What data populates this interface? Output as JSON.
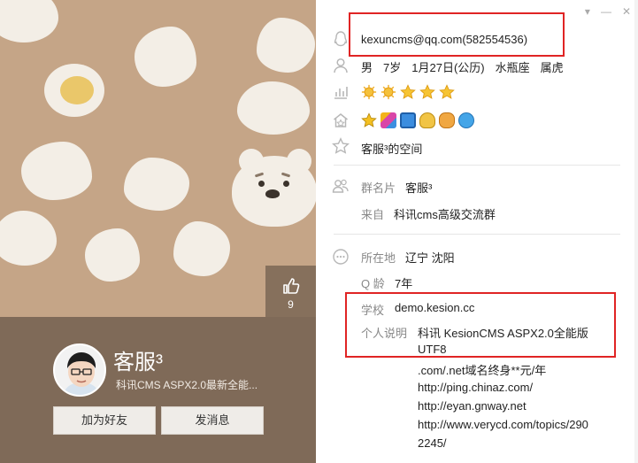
{
  "window": {
    "min_glyph": "▾",
    "min2_glyph": "—",
    "close_glyph": "✕"
  },
  "left": {
    "like_count": "9",
    "nickname": "客服³",
    "signature": "科讯CMS ASPX2.0最新全能...",
    "add_friend_label": "加为好友",
    "send_message_label": "发消息"
  },
  "profile": {
    "account": "kexuncms@qq.com(582554536)",
    "gender": "男",
    "age": "7岁",
    "birthday": "1月27日(公历)",
    "zodiac": "水瓶座",
    "chinese_zodiac": "属虎",
    "space_link": "客服³的空间",
    "group_card_label": "群名片",
    "group_card_value": "客服³",
    "from_label": "来自",
    "from_value": "科讯cms高级交流群",
    "location_label": "所在地",
    "location_value": "辽宁 沈阳",
    "qage_label": "Q 龄",
    "qage_value": "7年",
    "school_label": "学校",
    "school_value": "demo.kesion.cc",
    "bio_label": "个人说明",
    "bio_lines": [
      "科讯 KesionCMS ASPX2.0全能版",
      "UTF8",
      ".com/.net域名终身**元/年",
      "http://ping.chinaz.com/",
      "http://eyan.gnway.net",
      "http://www.verycd.com/topics/290",
      "2245/"
    ]
  },
  "colors": {
    "accent_red": "#e02424",
    "sun_yellow": "#f0b02a",
    "left_bg": "#c5a587",
    "bottom_band": "#7f6a58"
  },
  "icons": {
    "account": "qq-penguin-icon",
    "person": "person-icon",
    "level": "bar-chart-icon",
    "services": "house-icon",
    "space": "star-outline-icon",
    "card": "group-people-icon",
    "location": "dots-circle-icon",
    "like": "thumbs-up-icon"
  }
}
